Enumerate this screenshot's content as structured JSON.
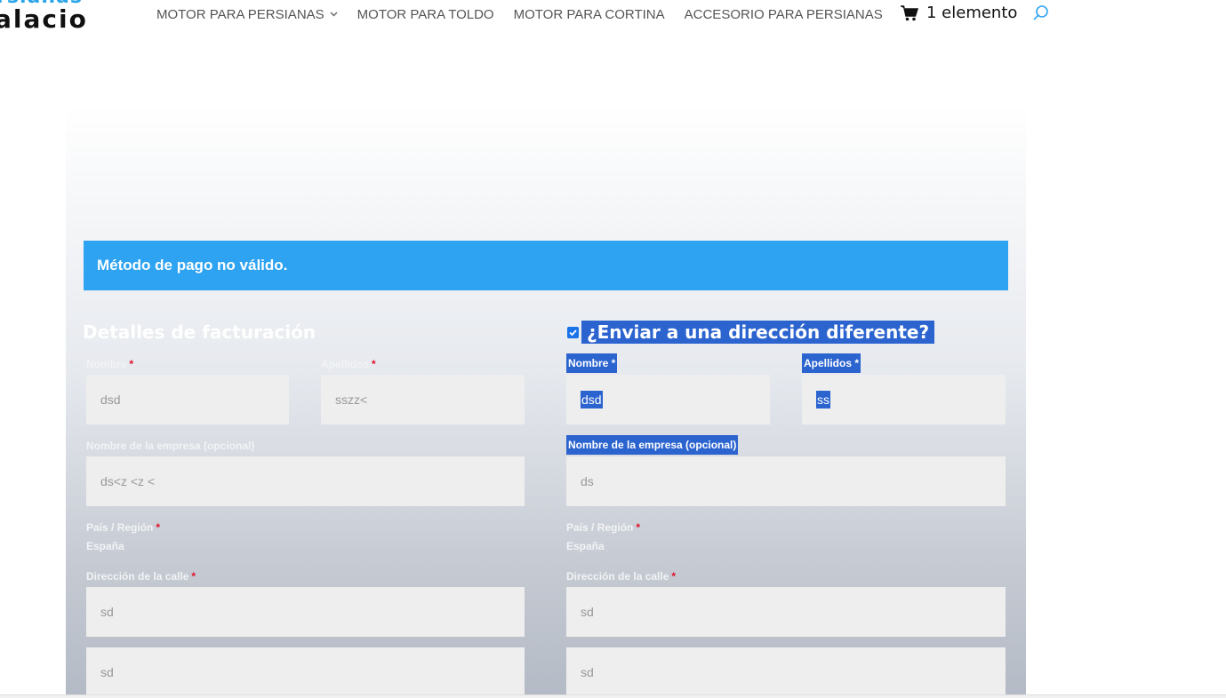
{
  "logo": {
    "line1": "rsianas",
    "line2": "alacio"
  },
  "nav": {
    "items": [
      "MOTOR PARA PERSIANAS",
      "MOTOR PARA TOLDO",
      "MOTOR PARA CORTINA",
      "ACCESORIO PARA PERSIANAS"
    ],
    "cart_label": "1 elemento"
  },
  "notice": "Método de pago no válido.",
  "billing": {
    "title": "Detalles de facturación",
    "first_name_label": "Nombre",
    "first_name_value": "dsd",
    "last_name_label": "Apellidos",
    "last_name_value": "sszz<",
    "company_label": "Nombre de la empresa (opcional)",
    "company_value": "ds<z <z <",
    "country_label": "País / Región",
    "country_value": "España",
    "street_label": "Dirección de la calle",
    "street_value": "sd",
    "street2_value": "sd"
  },
  "shipping": {
    "title": "¿Enviar a una dirección diferente?",
    "first_name_label": "Nombre *",
    "first_name_value": "dsd",
    "last_name_label": "Apellidos *",
    "last_name_value": "ss",
    "company_label": "Nombre de la empresa (opcional)",
    "company_value": "ds",
    "country_label": "País / Región",
    "country_value": "España",
    "street_label": "Dirección de la calle",
    "street_value": "sd",
    "street2_value": "sd"
  },
  "required_mark": "*",
  "colors": {
    "accent": "#2ea3f2",
    "selection": "#2b63cf",
    "required": "#e0102a",
    "field_bg": "#eeeeee"
  }
}
